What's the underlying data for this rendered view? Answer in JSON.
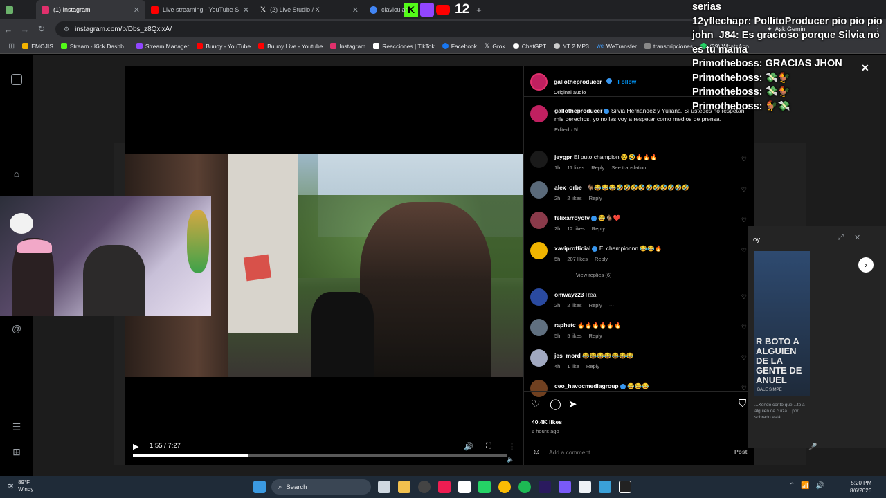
{
  "tabs": [
    {
      "label": "",
      "active": false,
      "favicon_color": "#6bb26b"
    },
    {
      "label": "(1) Instagram",
      "active": true,
      "favicon_color": "#e1306c"
    },
    {
      "label": "Live streaming - YouTube Studio",
      "active": false,
      "favicon_color": "#ff0000"
    },
    {
      "label": "(2) Live Studio / X",
      "active": false,
      "favicon_color": "#ffffff"
    },
    {
      "label": "clavicular",
      "active": false,
      "favicon_color": "#4285f4"
    }
  ],
  "new_tab_icon": "+",
  "overlay_logos": [
    "kick-icon",
    "twitch-icon",
    "youtube-icon",
    "12"
  ],
  "address": {
    "url": "instagram.com/p/Dbs_z8QxixA/"
  },
  "bookmarks": [
    {
      "label": "EMOJIS",
      "color": "#f4b400"
    },
    {
      "label": "Stream - Kick Dashb...",
      "color": "#53fc18"
    },
    {
      "label": "Stream Manager",
      "color": "#9146ff"
    },
    {
      "label": "Buuoy - YouTube",
      "color": "#ff0000"
    },
    {
      "label": "Buuoy Live - Youtube",
      "color": "#ff0000"
    },
    {
      "label": "Instagram",
      "color": "#e1306c"
    },
    {
      "label": "Reacciones | TikTok",
      "color": "#ffffff"
    },
    {
      "label": "Facebook",
      "color": "#1877f2"
    },
    {
      "label": "Grok",
      "color": "#ffffff"
    },
    {
      "label": "ChatGPT",
      "color": "#ffffff"
    },
    {
      "label": "YT 2 MP3",
      "color": "#cccccc"
    },
    {
      "label": "WeTransfer",
      "color": "#409fff"
    },
    {
      "label": "transcripciones",
      "color": "#888888"
    },
    {
      "label": "(29) WhatsApp",
      "color": "#25d366"
    }
  ],
  "ask_gemini": "Ask Gemini",
  "post": {
    "author": "gallotheproducer",
    "follow": "Follow",
    "audio": "Original audio",
    "caption_author": "gallotheproducer",
    "caption": "Silvia Hernandez y Yuliana. Si ustedes no respetan mis derechos, yo no las voy a respetar como medios de prensa.",
    "caption_meta": "Edited · 5h"
  },
  "comments": [
    {
      "user": "jeygpr",
      "verified": false,
      "text": "El puto champion 😵🤣🔥🔥🔥",
      "time": "1h",
      "likes": "11 likes",
      "reply": "Reply",
      "extra": "See translation",
      "avatar": "#1a1a1a"
    },
    {
      "user": "alex_orbe_",
      "verified": false,
      "text": "🐐😂😂😂🤣🤣🤣🤣🤣🤣🤣🤣🤣🤣",
      "time": "2h",
      "likes": "2 likes",
      "reply": "Reply",
      "extra": "",
      "avatar": "#5a6a7a"
    },
    {
      "user": "felixarroyotv",
      "verified": true,
      "text": "😂🐐❤️",
      "time": "2h",
      "likes": "12 likes",
      "reply": "Reply",
      "extra": "",
      "avatar": "#8a3a4a"
    },
    {
      "user": "xaviprofficial",
      "verified": true,
      "text": "El championnn 😂😂🔥",
      "time": "5h",
      "likes": "207 likes",
      "reply": "Reply",
      "extra": "",
      "avatar": "#f0b400"
    },
    {
      "user": "omwayz23",
      "verified": false,
      "text": "Real",
      "time": "2h",
      "likes": "2 likes",
      "reply": "Reply",
      "extra": "···",
      "avatar": "#2a4aa0"
    },
    {
      "user": "raphetc",
      "verified": false,
      "text": "🔥🔥🔥🔥🔥🔥",
      "time": "5h",
      "likes": "5 likes",
      "reply": "Reply",
      "extra": "",
      "avatar": "#607080"
    },
    {
      "user": "jes_mord",
      "verified": false,
      "text": "😂😂😂😂😂😂😂",
      "time": "4h",
      "likes": "1 like",
      "reply": "Reply",
      "extra": "",
      "avatar": "#a0a8c0"
    },
    {
      "user": "ceo_havocmediagroup",
      "verified": true,
      "text": "😂😂😂",
      "time": "",
      "likes": "",
      "reply": "",
      "extra": "",
      "avatar": "#704020"
    }
  ],
  "view_replies": "View replies (6)",
  "likes_count": "40.4K likes",
  "posted_ago": "6 hours ago",
  "comment_placeholder": "Add a comment...",
  "post_button": "Post",
  "video": {
    "timecode": "1:55 / 7:27",
    "progress_fraction": 0.31
  },
  "chat": [
    {
      "user": "",
      "text": "serias"
    },
    {
      "user": "12yflechapr:",
      "text": "PollitoProducer pio pio pio"
    },
    {
      "user": "john_J84:",
      "text": "Es gracioso porque Silvia no es tu mama"
    },
    {
      "user": "Primotheboss:",
      "text": "GRACIAS JHON"
    },
    {
      "user": "Primotheboss:",
      "text": "💸🐓"
    },
    {
      "user": "Primotheboss:",
      "text": "💸🐓"
    },
    {
      "user": "Primotheboss:",
      "text": "🐓💸"
    }
  ],
  "stream_card": {
    "name": "oy",
    "headline": "R BOTO A ALGUIEN DE LA GENTE DE ANUEL",
    "sub": "BALE SIMPE",
    "snippet": "...Xendo contó que ...to a alguien de cuiza ...por sobrado está..."
  },
  "taskbar": {
    "weather_temp": "89°F",
    "weather_desc": "Windy",
    "search": "Search",
    "time": "5:20 PM",
    "date": "8/6/2026"
  }
}
